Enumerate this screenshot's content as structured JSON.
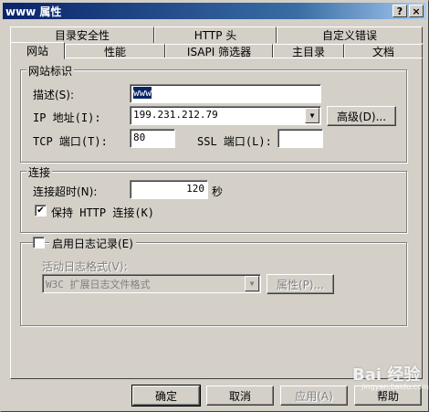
{
  "window": {
    "title": "www 属性",
    "help_button": "?",
    "close_button": "×"
  },
  "tabs": {
    "row_back": [
      "目录安全性",
      "HTTP 头",
      "自定义错误"
    ],
    "row_front": [
      "网站",
      "性能",
      "ISAPI 筛选器",
      "主目录",
      "文档"
    ],
    "active": "网站"
  },
  "site_id": {
    "group_title": "网站标识",
    "description_label": "描述(S):",
    "description_value": "www",
    "ip_label": "IP 地址(I):",
    "ip_value": "199.231.212.79",
    "advanced_button": "高级(D)...",
    "tcp_label": "TCP 端口(T):",
    "tcp_value": "80",
    "ssl_label": "SSL 端口(L):",
    "ssl_value": ""
  },
  "connection": {
    "group_title": "连接",
    "timeout_label": "连接超时(N):",
    "timeout_value": "120",
    "timeout_unit": "秒",
    "keepalive_label": "保持 HTTP 连接(K)",
    "keepalive_checked": true
  },
  "logging": {
    "enable_label": "启用日志记录(E)",
    "enable_checked": false,
    "format_label": "活动日志格式(V):",
    "format_value": "W3C 扩展日志文件格式",
    "properties_button": "属性(P)..."
  },
  "buttons": {
    "ok": "确定",
    "cancel": "取消",
    "apply": "应用(A)",
    "help": "帮助"
  },
  "watermark": {
    "text": "Bai 经验",
    "sub": "jingyan.baidu.com"
  }
}
